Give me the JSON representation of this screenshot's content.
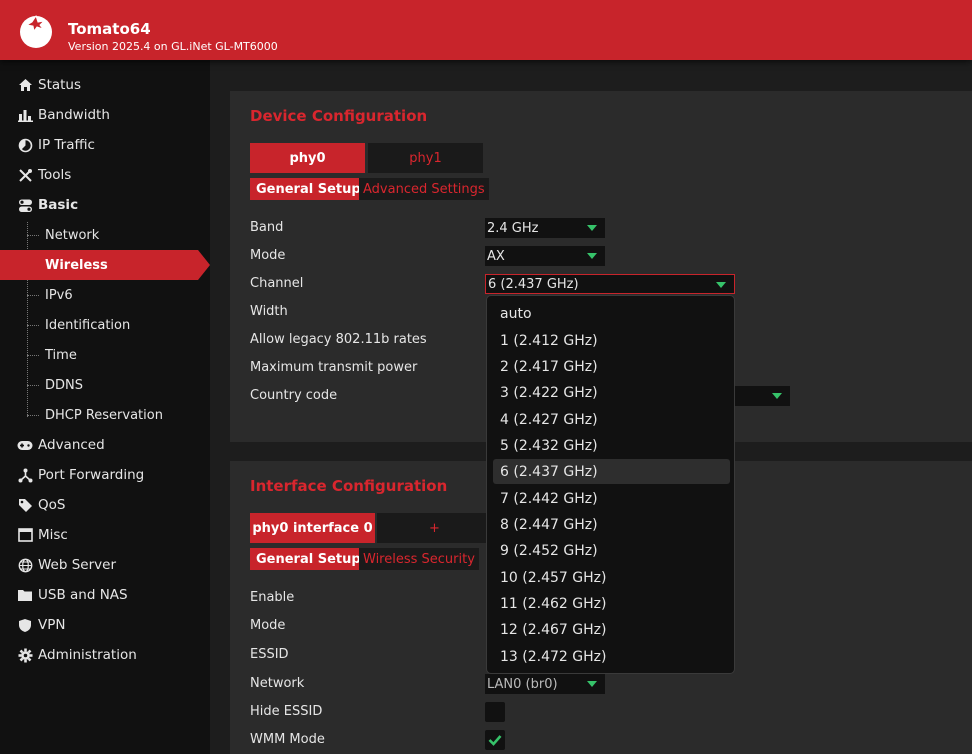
{
  "header": {
    "title": "Tomato64",
    "subtitle": "Version 2025.4 on GL.iNet GL-MT6000"
  },
  "sidebar": {
    "items": [
      {
        "label": "Status",
        "icon": "home-icon"
      },
      {
        "label": "Bandwidth",
        "icon": "bar-chart-icon"
      },
      {
        "label": "IP Traffic",
        "icon": "pie-chart-icon"
      },
      {
        "label": "Tools",
        "icon": "tools-icon"
      },
      {
        "label": "Basic",
        "icon": "toggle-icon"
      }
    ],
    "basic_sub": [
      "Network",
      "Wireless",
      "IPv6",
      "Identification",
      "Time",
      "DDNS",
      "DHCP Reservation"
    ],
    "items2": [
      {
        "label": "Advanced",
        "icon": "gamepad-icon"
      },
      {
        "label": "Port Forwarding",
        "icon": "network-icon"
      },
      {
        "label": "QoS",
        "icon": "tag-icon"
      },
      {
        "label": "Misc",
        "icon": "window-icon"
      },
      {
        "label": "Web Server",
        "icon": "globe-icon"
      },
      {
        "label": "USB and NAS",
        "icon": "folder-icon"
      },
      {
        "label": "VPN",
        "icon": "shield-icon"
      },
      {
        "label": "Administration",
        "icon": "gear-icon"
      }
    ]
  },
  "device_config": {
    "title": "Device Configuration",
    "tabs": [
      "phy0",
      "phy1"
    ],
    "subtabs": [
      "General Setup",
      "Advanced Settings"
    ],
    "rows": [
      "Band",
      "Mode",
      "Channel",
      "Width",
      "Allow legacy 802.11b rates",
      "Maximum transmit power",
      "Country code"
    ],
    "band_value": "2.4 GHz",
    "mode_value": "AX",
    "channel_value": "6 (2.437 GHz)"
  },
  "channel_options": [
    "auto",
    "1 (2.412 GHz)",
    "2 (2.417 GHz)",
    "3 (2.422 GHz)",
    "4 (2.427 GHz)",
    "5 (2.432 GHz)",
    "6 (2.437 GHz)",
    "7 (2.442 GHz)",
    "8 (2.447 GHz)",
    "9 (2.452 GHz)",
    "10 (2.457 GHz)",
    "11 (2.462 GHz)",
    "12 (2.467 GHz)",
    "13 (2.472 GHz)"
  ],
  "interface_config": {
    "title": "Interface Configuration",
    "tabs": [
      "phy0 interface 0",
      "+"
    ],
    "subtabs": [
      "General Setup",
      "Wireless Security"
    ],
    "rows": [
      "Enable",
      "Mode",
      "ESSID",
      "Network",
      "Hide ESSID",
      "WMM Mode"
    ],
    "network_value": "LAN0 (br0)"
  },
  "colors": {
    "accent": "#c8242b",
    "caret": "#36c36a"
  }
}
